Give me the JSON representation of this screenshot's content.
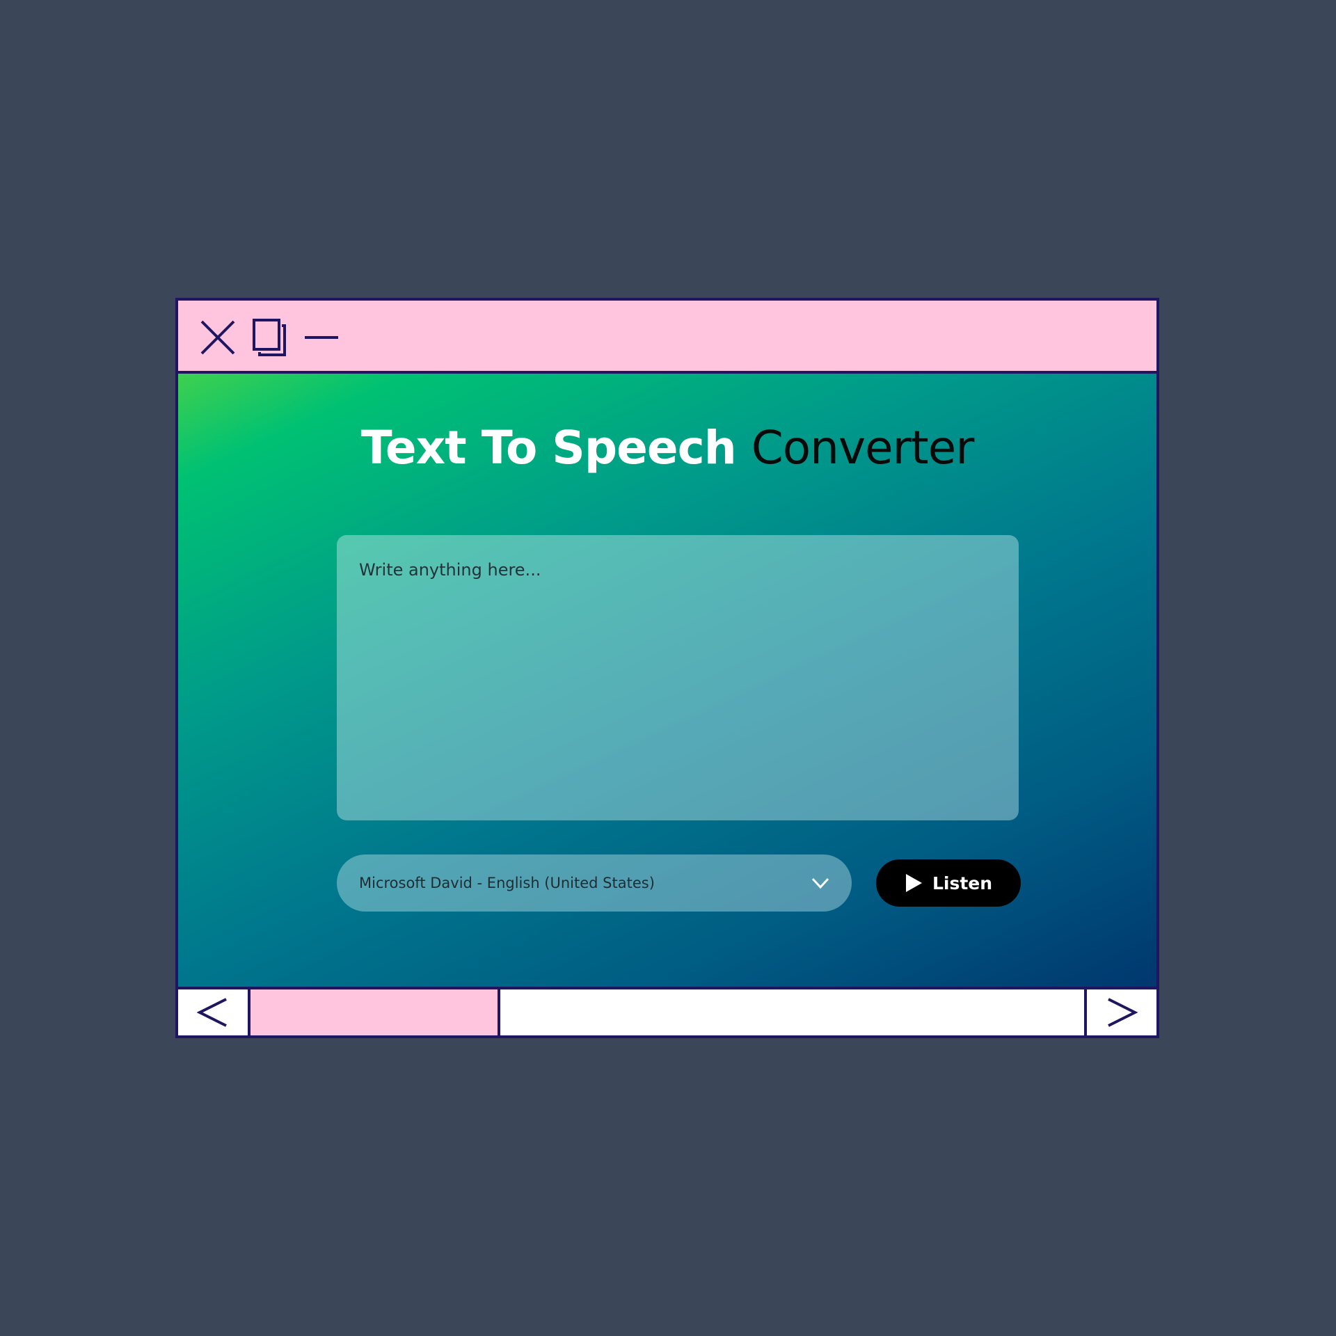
{
  "window": {
    "controls": {
      "close_icon": "close-icon",
      "restore_icon": "restore-icon",
      "minimize_icon": "minimize-icon"
    }
  },
  "main": {
    "title_part1": "Text To Speech",
    "title_part2": "Converter",
    "textarea_placeholder": "Write anything here...",
    "voice_select": {
      "selected": "Microsoft David - English (United States)",
      "icon": "chevron-down-icon"
    },
    "listen_button": {
      "label": "Listen",
      "icon": "play-icon"
    }
  },
  "scrollbar": {
    "prev_icon": "chevron-left-icon",
    "next_icon": "chevron-right-icon",
    "thumb_fraction": 0.3,
    "position_fraction": 0.0
  },
  "colors": {
    "background": "#3b4758",
    "titlebar": "#ffc5df",
    "border": "#1e1660",
    "listen_button": "#000000"
  }
}
